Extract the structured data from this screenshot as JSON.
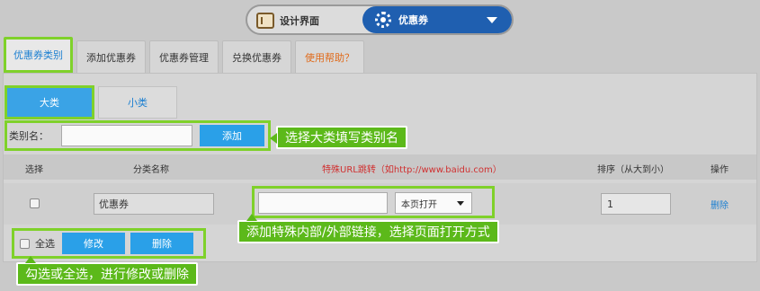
{
  "toggle": {
    "design_label": "设计界面",
    "coupon_label": "优惠券"
  },
  "tabs": [
    {
      "label": "优惠券类别"
    },
    {
      "label": "添加优惠券"
    },
    {
      "label": "优惠券管理"
    },
    {
      "label": "兑换优惠券"
    },
    {
      "label": "使用帮助？"
    }
  ],
  "subtabs": {
    "big": "大类",
    "small": "小类"
  },
  "add_form": {
    "label": "类别名：",
    "input_value": "",
    "add_button": "添加"
  },
  "callouts": {
    "add": "选择大类填写类别名",
    "link": "添加特殊内部/外部链接，选择页面打开方式",
    "bulk": "勾选或全选，进行修改或删除"
  },
  "table": {
    "headers": {
      "select": "选择",
      "name": "分类名称",
      "url": "特殊URL跳转（如http://www.baidu.com）",
      "sort": "排序（从大到小）",
      "action": "操作"
    },
    "rows": [
      {
        "name": "优惠券",
        "url": "",
        "open_mode": "本页打开",
        "sort": "1",
        "delete": "删除"
      }
    ]
  },
  "bulk": {
    "select_all": "全选",
    "edit_button": "修改",
    "delete_button": "删除"
  },
  "colors": {
    "accent_blue": "#2aa0e8",
    "highlight_green": "#7fd12a",
    "callout_green": "#5cb91a",
    "link_blue": "#1b7fd1"
  }
}
